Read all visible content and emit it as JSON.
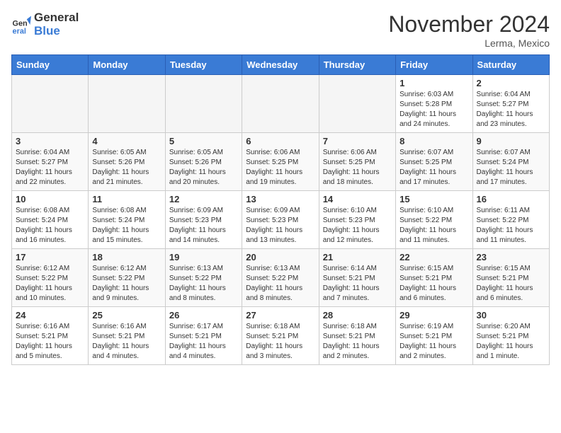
{
  "header": {
    "logo_line1": "General",
    "logo_line2": "Blue",
    "month": "November 2024",
    "location": "Lerma, Mexico"
  },
  "weekdays": [
    "Sunday",
    "Monday",
    "Tuesday",
    "Wednesday",
    "Thursday",
    "Friday",
    "Saturday"
  ],
  "weeks": [
    [
      {
        "day": "",
        "info": ""
      },
      {
        "day": "",
        "info": ""
      },
      {
        "day": "",
        "info": ""
      },
      {
        "day": "",
        "info": ""
      },
      {
        "day": "",
        "info": ""
      },
      {
        "day": "1",
        "info": "Sunrise: 6:03 AM\nSunset: 5:28 PM\nDaylight: 11 hours and 24 minutes."
      },
      {
        "day": "2",
        "info": "Sunrise: 6:04 AM\nSunset: 5:27 PM\nDaylight: 11 hours and 23 minutes."
      }
    ],
    [
      {
        "day": "3",
        "info": "Sunrise: 6:04 AM\nSunset: 5:27 PM\nDaylight: 11 hours and 22 minutes."
      },
      {
        "day": "4",
        "info": "Sunrise: 6:05 AM\nSunset: 5:26 PM\nDaylight: 11 hours and 21 minutes."
      },
      {
        "day": "5",
        "info": "Sunrise: 6:05 AM\nSunset: 5:26 PM\nDaylight: 11 hours and 20 minutes."
      },
      {
        "day": "6",
        "info": "Sunrise: 6:06 AM\nSunset: 5:25 PM\nDaylight: 11 hours and 19 minutes."
      },
      {
        "day": "7",
        "info": "Sunrise: 6:06 AM\nSunset: 5:25 PM\nDaylight: 11 hours and 18 minutes."
      },
      {
        "day": "8",
        "info": "Sunrise: 6:07 AM\nSunset: 5:25 PM\nDaylight: 11 hours and 17 minutes."
      },
      {
        "day": "9",
        "info": "Sunrise: 6:07 AM\nSunset: 5:24 PM\nDaylight: 11 hours and 17 minutes."
      }
    ],
    [
      {
        "day": "10",
        "info": "Sunrise: 6:08 AM\nSunset: 5:24 PM\nDaylight: 11 hours and 16 minutes."
      },
      {
        "day": "11",
        "info": "Sunrise: 6:08 AM\nSunset: 5:24 PM\nDaylight: 11 hours and 15 minutes."
      },
      {
        "day": "12",
        "info": "Sunrise: 6:09 AM\nSunset: 5:23 PM\nDaylight: 11 hours and 14 minutes."
      },
      {
        "day": "13",
        "info": "Sunrise: 6:09 AM\nSunset: 5:23 PM\nDaylight: 11 hours and 13 minutes."
      },
      {
        "day": "14",
        "info": "Sunrise: 6:10 AM\nSunset: 5:23 PM\nDaylight: 11 hours and 12 minutes."
      },
      {
        "day": "15",
        "info": "Sunrise: 6:10 AM\nSunset: 5:22 PM\nDaylight: 11 hours and 11 minutes."
      },
      {
        "day": "16",
        "info": "Sunrise: 6:11 AM\nSunset: 5:22 PM\nDaylight: 11 hours and 11 minutes."
      }
    ],
    [
      {
        "day": "17",
        "info": "Sunrise: 6:12 AM\nSunset: 5:22 PM\nDaylight: 11 hours and 10 minutes."
      },
      {
        "day": "18",
        "info": "Sunrise: 6:12 AM\nSunset: 5:22 PM\nDaylight: 11 hours and 9 minutes."
      },
      {
        "day": "19",
        "info": "Sunrise: 6:13 AM\nSunset: 5:22 PM\nDaylight: 11 hours and 8 minutes."
      },
      {
        "day": "20",
        "info": "Sunrise: 6:13 AM\nSunset: 5:22 PM\nDaylight: 11 hours and 8 minutes."
      },
      {
        "day": "21",
        "info": "Sunrise: 6:14 AM\nSunset: 5:21 PM\nDaylight: 11 hours and 7 minutes."
      },
      {
        "day": "22",
        "info": "Sunrise: 6:15 AM\nSunset: 5:21 PM\nDaylight: 11 hours and 6 minutes."
      },
      {
        "day": "23",
        "info": "Sunrise: 6:15 AM\nSunset: 5:21 PM\nDaylight: 11 hours and 6 minutes."
      }
    ],
    [
      {
        "day": "24",
        "info": "Sunrise: 6:16 AM\nSunset: 5:21 PM\nDaylight: 11 hours and 5 minutes."
      },
      {
        "day": "25",
        "info": "Sunrise: 6:16 AM\nSunset: 5:21 PM\nDaylight: 11 hours and 4 minutes."
      },
      {
        "day": "26",
        "info": "Sunrise: 6:17 AM\nSunset: 5:21 PM\nDaylight: 11 hours and 4 minutes."
      },
      {
        "day": "27",
        "info": "Sunrise: 6:18 AM\nSunset: 5:21 PM\nDaylight: 11 hours and 3 minutes."
      },
      {
        "day": "28",
        "info": "Sunrise: 6:18 AM\nSunset: 5:21 PM\nDaylight: 11 hours and 2 minutes."
      },
      {
        "day": "29",
        "info": "Sunrise: 6:19 AM\nSunset: 5:21 PM\nDaylight: 11 hours and 2 minutes."
      },
      {
        "day": "30",
        "info": "Sunrise: 6:20 AM\nSunset: 5:21 PM\nDaylight: 11 hours and 1 minute."
      }
    ]
  ]
}
